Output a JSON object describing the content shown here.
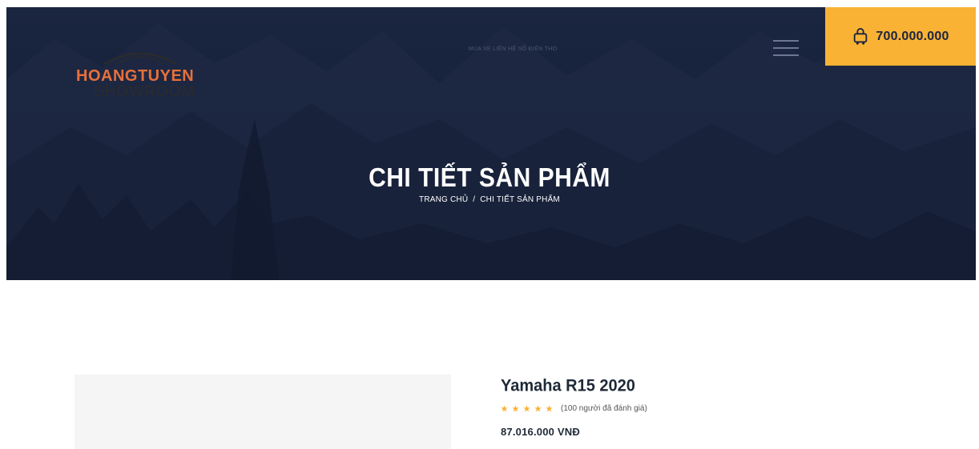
{
  "header": {
    "logo": {
      "brand": "HOANGTUYEN",
      "sub": "SHOWROOM"
    },
    "notice": "MUA XE LIÊN HỆ SỐ ĐIỆN THO",
    "menu_icon": "hamburger-icon",
    "cart": {
      "icon": "shopping-cart-icon",
      "total": "700.000.000"
    }
  },
  "hero": {
    "title": "CHI TIẾT SẢN PHẨM",
    "breadcrumb": {
      "home": "TRANG CHỦ",
      "separator": "/",
      "current": "CHI TIẾT SẢN PHẨM"
    }
  },
  "product": {
    "name": "Yamaha R15 2020",
    "rating": {
      "stars": 5,
      "max": 5,
      "text": "(100 người đã đánh giá)"
    },
    "price": "87.016.000 VNĐ"
  },
  "colors": {
    "hero_bg": "#1a2540",
    "accent": "#f9b233",
    "logo_orange": "#e8703a",
    "star": "#f9b233"
  }
}
